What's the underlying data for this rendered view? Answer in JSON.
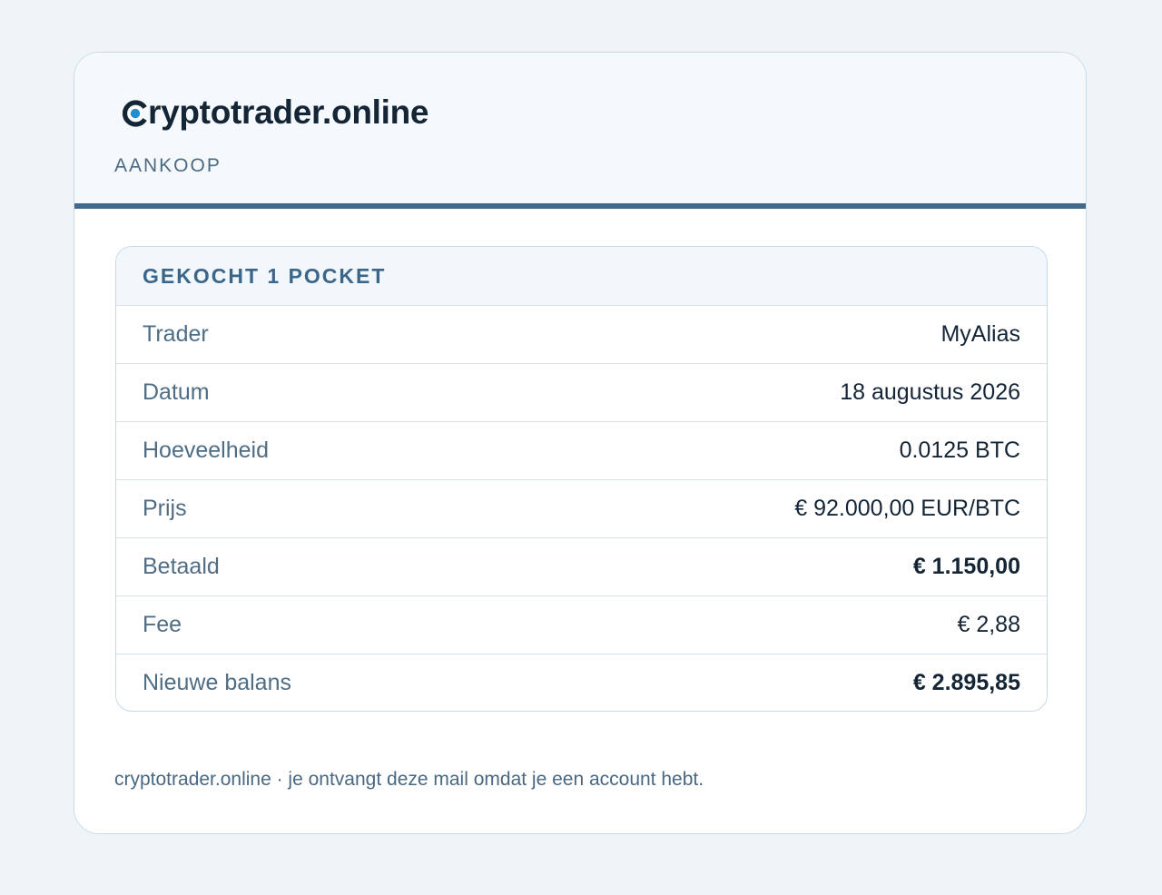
{
  "brand": {
    "name": "ryptotrader.online",
    "accent_color": "#1e8fd0",
    "mark_icon": "logo-c-circle-icon"
  },
  "header": {
    "section_label": "AANKOOP"
  },
  "panel": {
    "title": "GEKOCHT 1 POCKET",
    "rows": [
      {
        "label": "Trader",
        "value": "MyAlias"
      },
      {
        "label": "Datum",
        "value": "18 augustus 2026"
      },
      {
        "label": "Hoeveelheid",
        "value": "0.0125 BTC"
      },
      {
        "label": "Prijs",
        "value": "€ 92.000,00 EUR/BTC"
      },
      {
        "label": "Betaald",
        "value": "€ 1.150,00"
      },
      {
        "label": "Fee",
        "value": "€ 2,88"
      },
      {
        "label": "Nieuwe balans",
        "value": "€ 2.895,85"
      }
    ]
  },
  "footer": {
    "text": "cryptotrader.online · je ontvangt deze mail omdat je een account hebt."
  }
}
